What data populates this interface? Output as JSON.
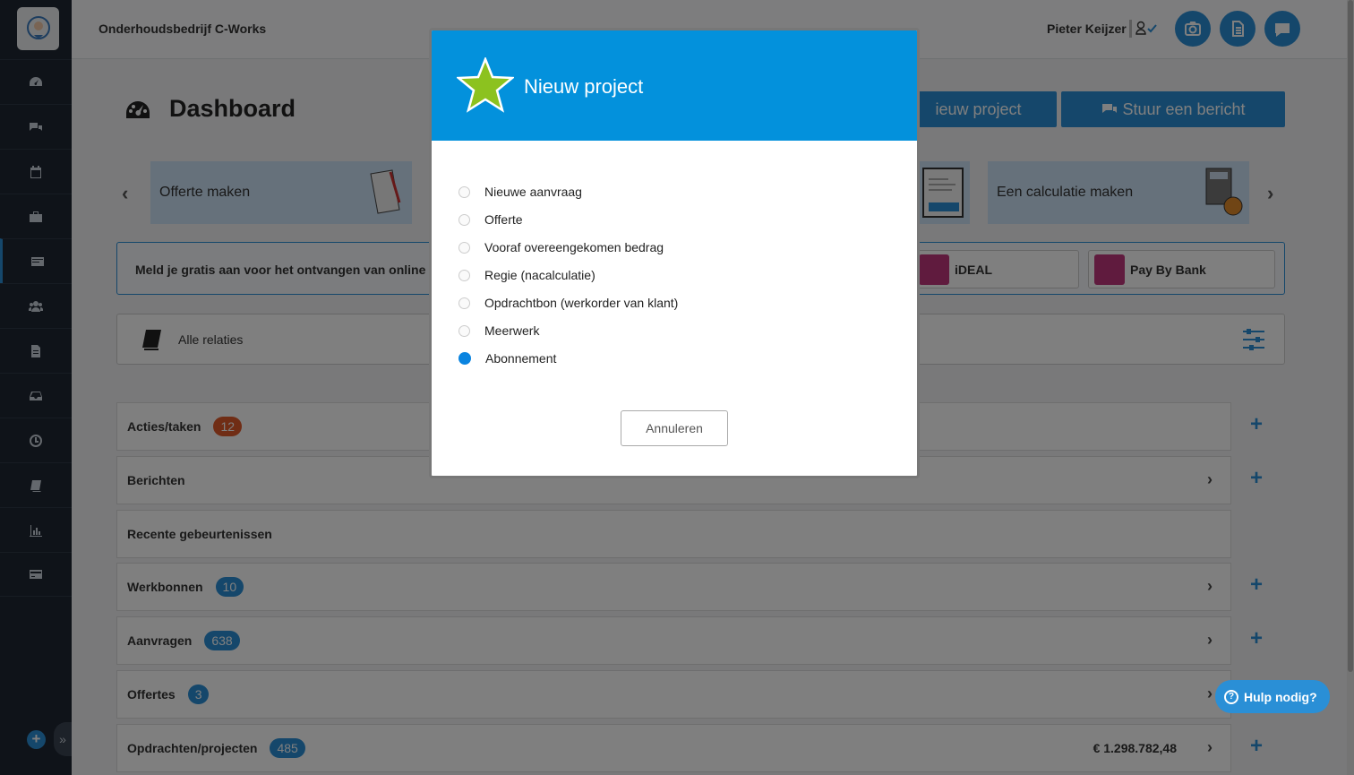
{
  "header": {
    "company": "Onderhoudsbedrijf C-Works",
    "username": "Pieter Keijzer"
  },
  "sidebar": {
    "items": [
      "dashboard-icon",
      "chat-icon",
      "calendar-icon",
      "briefcase-icon",
      "invoice-icon",
      "users-icon",
      "document-icon",
      "inbox-icon",
      "clock-icon",
      "book-icon",
      "chart-icon",
      "card-icon"
    ]
  },
  "main": {
    "title": "Dashboard",
    "btn_new_project": "ieuw project",
    "btn_send_message": "Stuur een bericht",
    "cards": {
      "quote": "Offerte maken",
      "calc": "Een calculatie maken"
    },
    "payment": {
      "text": "Meld je gratis aan voor het ontvangen van online bet",
      "ideal": "iDEAL",
      "paybybank": "Pay By Bank"
    },
    "filter": {
      "label": "Alle relaties"
    },
    "rows": [
      {
        "label": "Acties/taken",
        "badge": "12"
      },
      {
        "label": "Berichten"
      },
      {
        "label": "Recente gebeurtenissen"
      },
      {
        "label": "Werkbonnen",
        "badge": "10"
      },
      {
        "label": "Aanvragen",
        "badge": "638"
      },
      {
        "label": "Offertes",
        "badge": "3"
      },
      {
        "label": "Opdrachten/projecten",
        "badge": "485",
        "amount": "€  1.298.782,48"
      }
    ],
    "help": "Hulp nodig?"
  },
  "modal": {
    "title": "Nieuw project",
    "options": [
      "Nieuwe aanvraag",
      "Offerte",
      "Vooraf overeengekomen bedrag",
      "Regie (nacalculatie)",
      "Opdrachtbon (werkorder van klant)",
      "Meerwerk",
      "Abonnement"
    ],
    "selected_index": 6,
    "cancel": "Annuleren"
  },
  "colors": {
    "accent": "#2a8fd6",
    "modal_header": "#0391dc",
    "sidebar": "#1f2733",
    "badge_red": "#e05a2b",
    "star": "#8cc21f"
  }
}
